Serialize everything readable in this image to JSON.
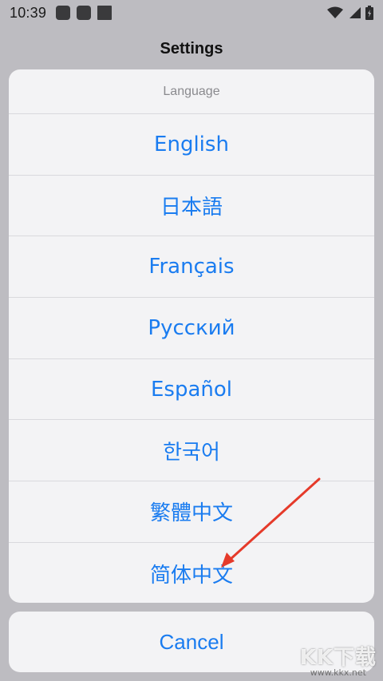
{
  "status_bar": {
    "time": "10:39",
    "icons": [
      "notification-icon",
      "notification-icon",
      "notification-icon",
      "wifi-icon",
      "signal-icon",
      "battery-icon"
    ]
  },
  "nav": {
    "title": "Settings"
  },
  "language_sheet": {
    "title": "Language",
    "options": [
      {
        "label": "English"
      },
      {
        "label": "日本語"
      },
      {
        "label": "Français"
      },
      {
        "label": "Русский"
      },
      {
        "label": "Español"
      },
      {
        "label": "한국어"
      },
      {
        "label": "繁體中文"
      },
      {
        "label": "简体中文"
      }
    ]
  },
  "cancel": {
    "label": "Cancel"
  },
  "watermark": {
    "text": "KK下载",
    "sub": "www.kkx.net"
  },
  "colors": {
    "accent": "#1a7cf0",
    "annotation_arrow": "#e53a2a",
    "backdrop": "#bdbcc1"
  }
}
